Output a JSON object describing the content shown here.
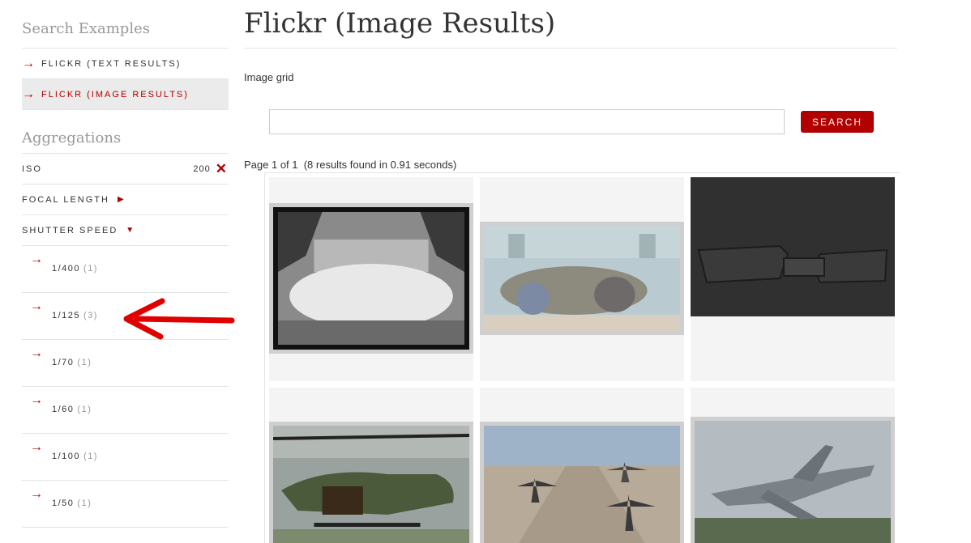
{
  "sidebar": {
    "examples_heading": "Search Examples",
    "examples": [
      {
        "label": "FLICKR (TEXT RESULTS)",
        "active": false
      },
      {
        "label": "FLICKR (IMAGE RESULTS)",
        "active": true
      }
    ],
    "aggregations_heading": "Aggregations",
    "iso": {
      "label": "ISO",
      "value": "200"
    },
    "focal_length": {
      "label": "FOCAL LENGTH"
    },
    "shutter_speed": {
      "label": "SHUTTER SPEED"
    },
    "shutter_values": [
      {
        "label": "1/400",
        "count": "(1)"
      },
      {
        "label": "1/125",
        "count": "(3)"
      },
      {
        "label": "1/70",
        "count": "(1)"
      },
      {
        "label": "1/60",
        "count": "(1)"
      },
      {
        "label": "1/100",
        "count": "(1)"
      },
      {
        "label": "1/50",
        "count": "(1)"
      }
    ]
  },
  "main": {
    "title": "Flickr (Image Results)",
    "grid_label": "Image grid",
    "search": {
      "value": "",
      "placeholder": "",
      "button_label": "SEARCH"
    },
    "page_info": "Page 1 of 1  (8 results found in 0.91 seconds)"
  },
  "colors": {
    "accent": "#b00000",
    "muted": "#999999",
    "active_bg": "#ebebeb"
  },
  "icons": {
    "arrow": "right-arrow-icon",
    "remove": "close-x-icon",
    "expand": "triangle-right-icon",
    "collapse": "triangle-down-icon"
  }
}
